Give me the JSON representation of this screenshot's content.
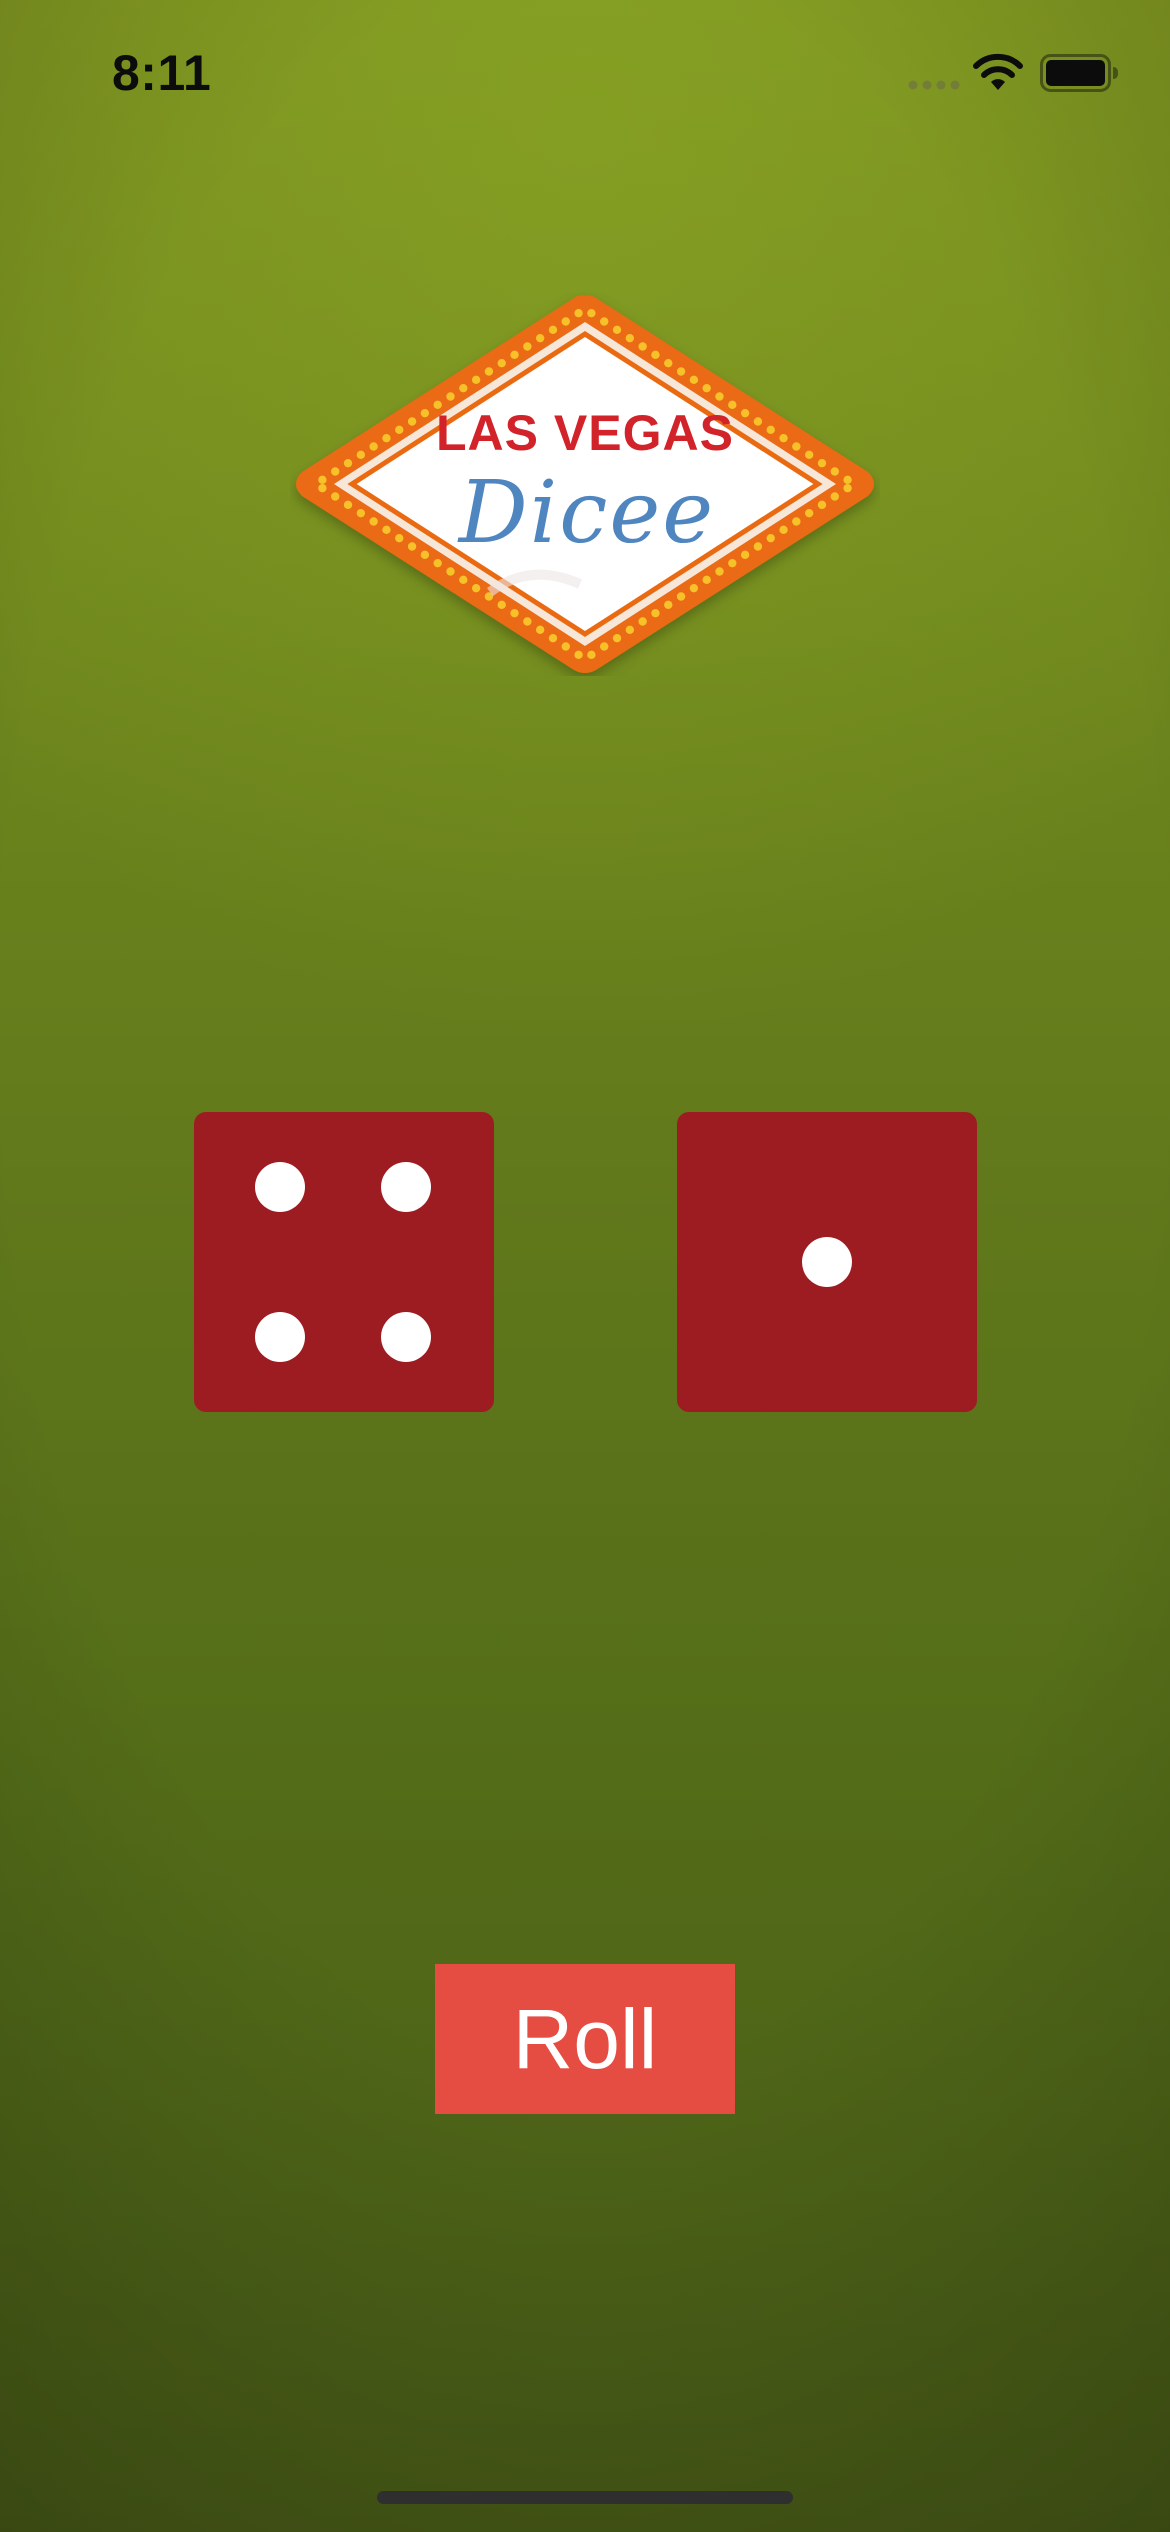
{
  "status_bar": {
    "time": "8:11",
    "icons": [
      "signal-dots-icon",
      "wifi-icon",
      "battery-icon"
    ]
  },
  "logo": {
    "line1": "LAS VEGAS",
    "line2": "Dicee",
    "colors": {
      "frame_orange": "#ea6a12",
      "bulbs": "#f7c12a",
      "line1_red": "#d2232a",
      "line2_blue": "#4f86c0"
    }
  },
  "dice": [
    {
      "name": "left-die",
      "face": 4
    },
    {
      "name": "right-die",
      "face": 1
    }
  ],
  "roll_button": {
    "label": "Roll"
  },
  "colors": {
    "felt_top": "#7e9420",
    "felt_bottom": "#485b17",
    "die": "#9c1c22",
    "pip": "#ffffff",
    "button": "#e54d42"
  }
}
